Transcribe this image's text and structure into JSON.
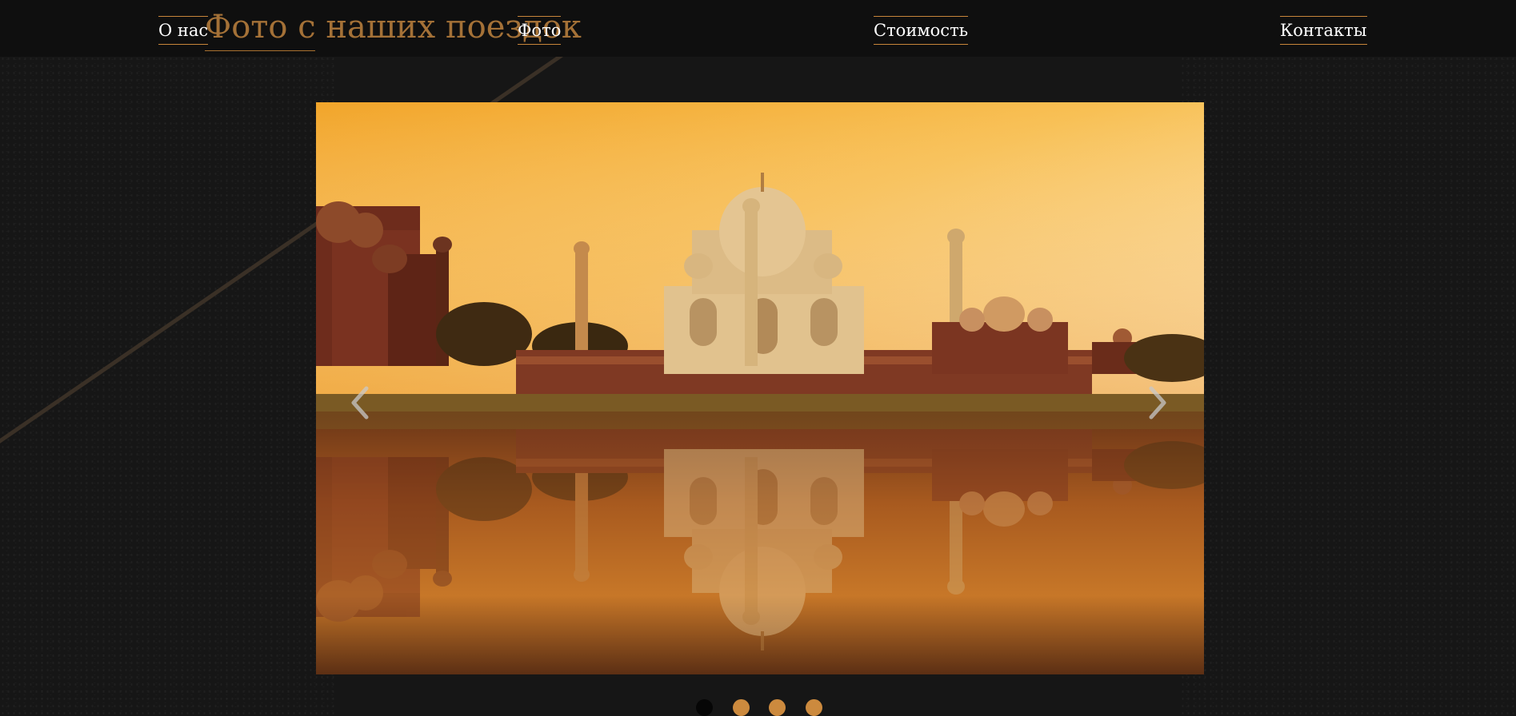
{
  "nav": {
    "items": [
      {
        "label": "О нас"
      },
      {
        "label": "Фото"
      },
      {
        "label": "Стоимость"
      },
      {
        "label": "Контакты"
      }
    ]
  },
  "hero": {
    "title": "Фото с наших поездок"
  },
  "slider": {
    "slide_count": 4,
    "active_slide": 1,
    "prev_icon": "chevron-left-icon",
    "next_icon": "chevron-right-icon"
  },
  "colors": {
    "accent": "#cc8a3e",
    "background": "#161616",
    "header": "#0f0f0f"
  }
}
